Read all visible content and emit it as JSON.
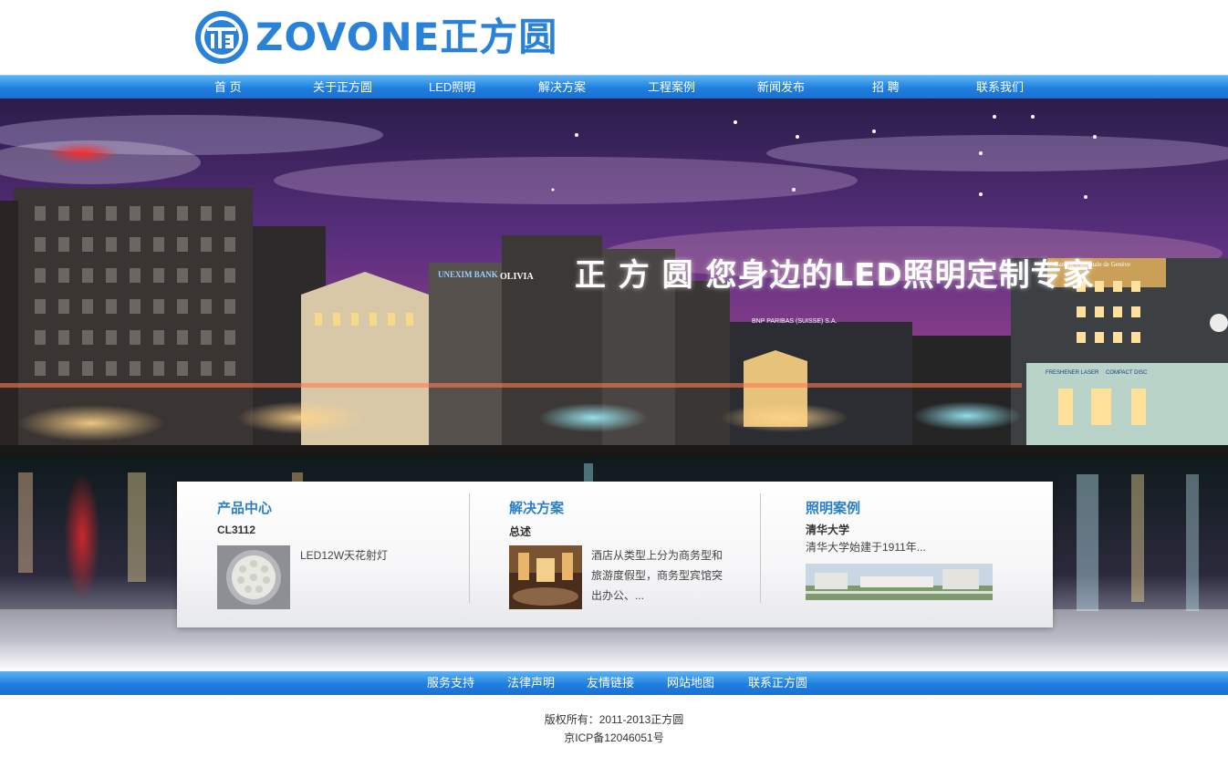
{
  "header": {
    "logo_text": "ZOVONE正方圆",
    "logo_color": "#2a82d8"
  },
  "nav": {
    "items": [
      {
        "label": "首  页"
      },
      {
        "label": "关于正方圆"
      },
      {
        "label": "LED照明"
      },
      {
        "label": "解决方案"
      },
      {
        "label": "工程案例"
      },
      {
        "label": "新闻发布"
      },
      {
        "label": "招  聘"
      },
      {
        "label": "联系我们"
      }
    ]
  },
  "banner": {
    "slogan": "正 方 圆  您身边的LED照明定制专家",
    "signs": [
      "UNEXIM BANK",
      "OLIVIA",
      "BNP PARIBAS (SUISSE) S.A.",
      "FRESHENER LASER",
      "COMPACT DISC",
      "Banque Cantonale de Genève"
    ]
  },
  "panel": {
    "products": {
      "title": "产品中心",
      "subtitle": "CL3112",
      "desc": "LED12W天花射灯"
    },
    "solutions": {
      "title": "解决方案",
      "subtitle": "总述",
      "desc": "酒店从类型上分为商务型和旅游度假型，商务型宾馆突出办公、..."
    },
    "cases": {
      "title": "照明案例",
      "subtitle": "清华大学",
      "desc": "清华大学始建于1911年..."
    }
  },
  "footer": {
    "links": [
      {
        "label": "服务支持"
      },
      {
        "label": "法律声明"
      },
      {
        "label": "友情链接"
      },
      {
        "label": "网站地图"
      },
      {
        "label": "联系正方圆"
      }
    ],
    "copyright": "版权所有：2011-2013正方圆",
    "icp": "京ICP备12046051号"
  },
  "colors": {
    "nav_blue": "#1f7fe0",
    "title_blue": "#2a7fc8"
  }
}
